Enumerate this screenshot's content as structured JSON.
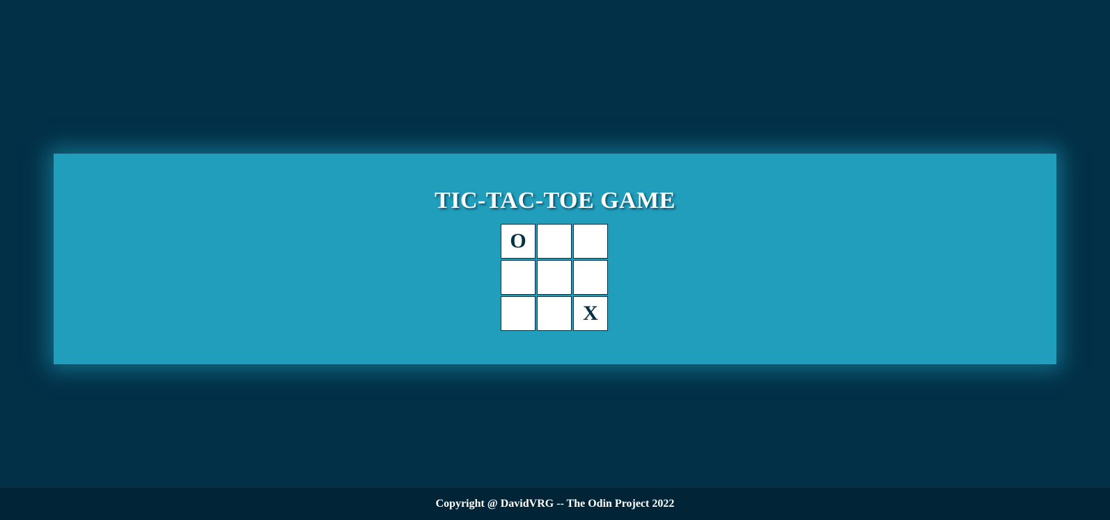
{
  "game": {
    "title": "TIC-TAC-TOE GAME",
    "board": [
      "O",
      "",
      "",
      "",
      "",
      "",
      "",
      "",
      "X"
    ]
  },
  "footer": {
    "text": "Copyright @ DavidVRG -- The Odin Project 2022"
  },
  "colors": {
    "page_background": "#023047",
    "panel_background": "#219ebc",
    "cell_background": "#ffffff",
    "mark_color": "#023047",
    "footer_background": "#012536"
  }
}
